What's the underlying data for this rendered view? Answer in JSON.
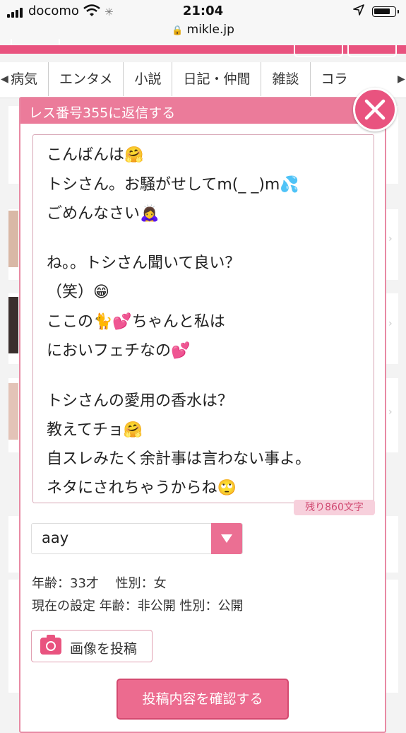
{
  "status_bar": {
    "carrier": "docomo",
    "time": "21:04",
    "url": "mikle.jp"
  },
  "nav": {
    "categories": [
      "病気",
      "エンタメ",
      "小説",
      "日記・仲間",
      "雑談",
      "コラ"
    ]
  },
  "modal": {
    "title": "レス番号355に返信する",
    "message_lines": [
      "こんばんは🤗",
      "トシさん。お騒がせしてm(_ _)m💦",
      "ごめんなさい🙇‍♀️",
      "",
      "ね。。トシさん聞いて良い？",
      "（笑）😁",
      "ここの🐈💕ちゃんと私は",
      "においフェチなの💕",
      "",
      "トシさんの愛用の香水は？",
      "教えてチョ🤗",
      "自スレみたく余計事は言わない事よ。",
      "ネタにされちゃうからね🙄"
    ],
    "char_remaining": "残り860文字",
    "name_value": "aay",
    "profile_age_gender": "年齢：33才　 性別：女",
    "current_settings": "現在の設定 年齢：非公開 性別：公開",
    "image_button_label": "画像を投稿",
    "confirm_button_label": "投稿内容を確認する"
  },
  "colors": {
    "accent": "#e9537f",
    "title_bar": "#eb7b9a",
    "count_badge_bg": "#f7d0dc"
  },
  "icons": [
    "signal-icon",
    "wifi-icon",
    "loading-icon",
    "lock-icon",
    "location-arrow-icon",
    "battery-icon",
    "close-icon",
    "dropdown-arrow-icon",
    "camera-icon"
  ]
}
